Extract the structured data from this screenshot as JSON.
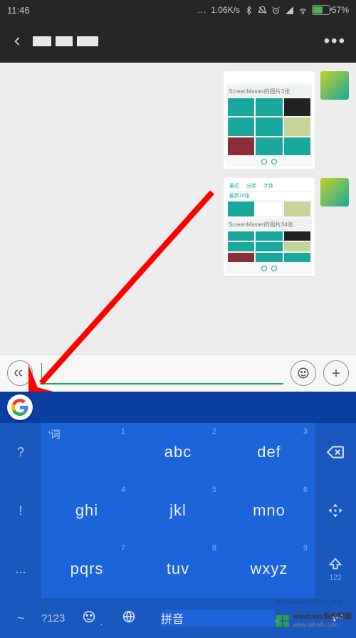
{
  "status": {
    "time": "11:46",
    "net_speed": "1.06K/s",
    "battery_pct": "57%"
  },
  "chat": {
    "caption1": "ScreenMaster的图片3张",
    "caption2": "ScreenMaster的图片34张",
    "thumb_tab1": "最近",
    "thumb_tab2": "分类",
    "thumb_tab3": "字体",
    "thumb_sub": "最新10张"
  },
  "keyboard": {
    "side": {
      "r1": "?",
      "r2": "!",
      "r3": "...",
      "r4": "~"
    },
    "keys": {
      "k1": {
        "word": "'词",
        "num": "1"
      },
      "k2": {
        "lab": "abc",
        "num": "2"
      },
      "k3": {
        "lab": "def",
        "num": "3"
      },
      "k4": {
        "lab": "ghi",
        "num": "4"
      },
      "k5": {
        "lab": "jkl",
        "num": "5"
      },
      "k6": {
        "lab": "mno",
        "num": "6"
      },
      "k7": {
        "lab": "pqrs",
        "num": "7"
      },
      "k8": {
        "lab": "tuv",
        "num": "8"
      },
      "k9": {
        "lab": "wxyz",
        "num": "9"
      }
    },
    "bottom": {
      "sym": "?123",
      "comma": ",",
      "space": "拼音",
      "period": "。",
      "shift_sub": "123"
    }
  },
  "watermark": {
    "brand": "windows系统家园",
    "url": "www.ruihaifu.com"
  }
}
